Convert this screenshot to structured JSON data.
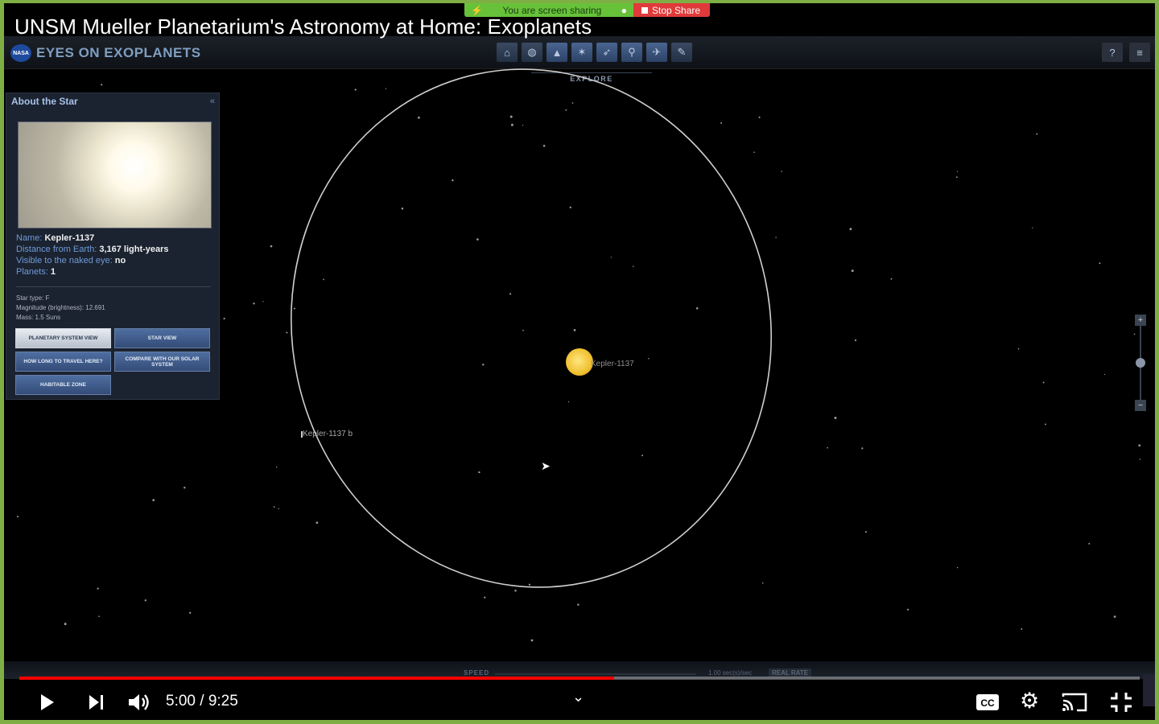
{
  "share": {
    "message": "You are screen sharing",
    "stop_label": "Stop Share"
  },
  "video": {
    "title": "UNSM Mueller Planetarium's Astronomy at Home: Exoplanets"
  },
  "app": {
    "logo_text": "EYES ON EXOPLANETS",
    "logo_badge": "NASA",
    "explore_label": "EXPLORE"
  },
  "nav": {
    "icons": [
      "home-icon",
      "globe-icon",
      "planetarium-icon",
      "star-view-icon",
      "rocket-icon",
      "search-icon",
      "satellite-icon",
      "wrench-icon"
    ],
    "right": {
      "help": "?",
      "menu": "≡"
    }
  },
  "panel": {
    "title": "About the Star",
    "name_key": "Name:",
    "name_val": "Kepler-1137",
    "dist_key": "Distance from Earth:",
    "dist_val": "3,167 light-years",
    "naked_key": "Visible to the naked eye:",
    "naked_val": "no",
    "planets_key": "Planets:",
    "planets_val": "1",
    "star_type": "Star type: F",
    "magnitude": "Magnitude (brightness): 12.691",
    "mass": "Mass: 1.5 Suns",
    "buttons": {
      "planetary": "PLANETARY SYSTEM VIEW",
      "star_view": "STAR VIEW",
      "travel": "HOW LONG TO TRAVEL HERE?",
      "compare": "COMPARE WITH OUR SOLAR SYSTEM",
      "habitable": "HABITABLE ZONE"
    }
  },
  "scene": {
    "star_label": "Kepler-1137",
    "planet_label": "Kepler-1137 b"
  },
  "speed": {
    "label": "SPEED",
    "value": "1.00 sec(s)/sec",
    "real_rate": "REAL RATE"
  },
  "player": {
    "current": "5:00",
    "duration": "9:25",
    "time_text": "5:00 / 9:25",
    "progress": 0.531
  }
}
